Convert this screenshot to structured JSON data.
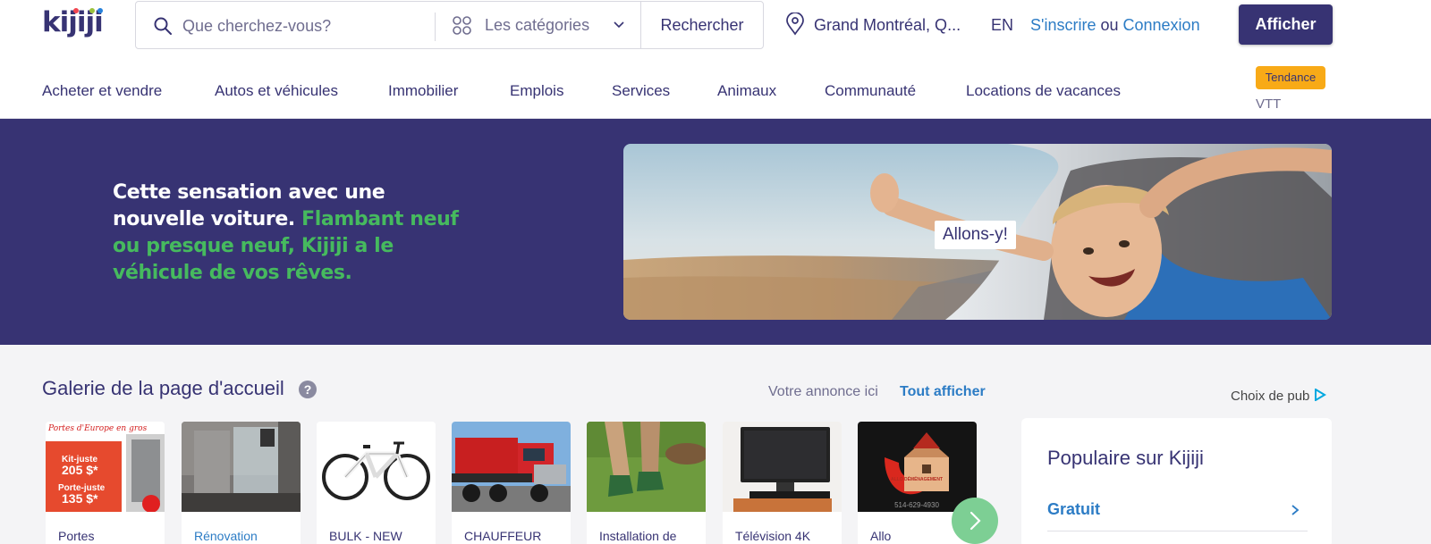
{
  "header": {
    "logo": "kijiji",
    "search_placeholder": "Que cherchez-vous?",
    "categories_label": "Les catégories",
    "search_button": "Rechercher",
    "location": "Grand Montréal, Q...",
    "language": "EN",
    "signup": "S'inscrire",
    "or": "ou",
    "login": "Connexion",
    "post_ad": "Afficher"
  },
  "nav": {
    "items": [
      "Acheter et vendre",
      "Autos et véhicules",
      "Immobilier",
      "Emplois",
      "Services",
      "Animaux",
      "Communauté",
      "Locations de vacances"
    ],
    "trending_badge": "Tendance",
    "trending_item": "VTT"
  },
  "hero": {
    "headline": "Cette sensation avec une nouvelle voiture.",
    "subline": "Flambant neuf ou presque neuf, Kijiji a le véhicule de vos rêves.",
    "image_caption": "Allons-y!"
  },
  "gallery": {
    "title": "Galerie de la page d'accueil",
    "help": "?",
    "your_ad": "Votre annonce ici",
    "see_all": "Tout afficher",
    "ad_choice": "Choix de pub",
    "cards": [
      {
        "title": "Portes",
        "image_text": [
          "Portes d'Europe en gros",
          "Kit-juste",
          "205 $*",
          "Porte-juste",
          "135 $*"
        ]
      },
      {
        "title": "Rénovation"
      },
      {
        "title": "BULK - NEW"
      },
      {
        "title": "CHAUFFEUR"
      },
      {
        "title": "Installation de"
      },
      {
        "title": "Télévision 4K"
      },
      {
        "title": "Allo",
        "image_text": [
          "ALLO DÉMÉNAGEMENT",
          "514-629-4930"
        ]
      }
    ]
  },
  "popular": {
    "title": "Populaire sur Kijiji",
    "items": [
      "Gratuit"
    ]
  },
  "colors": {
    "brand": "#373373",
    "link": "#2c7cc5",
    "accent_green": "#46ba5e",
    "trend_badge": "#f8aa17"
  }
}
